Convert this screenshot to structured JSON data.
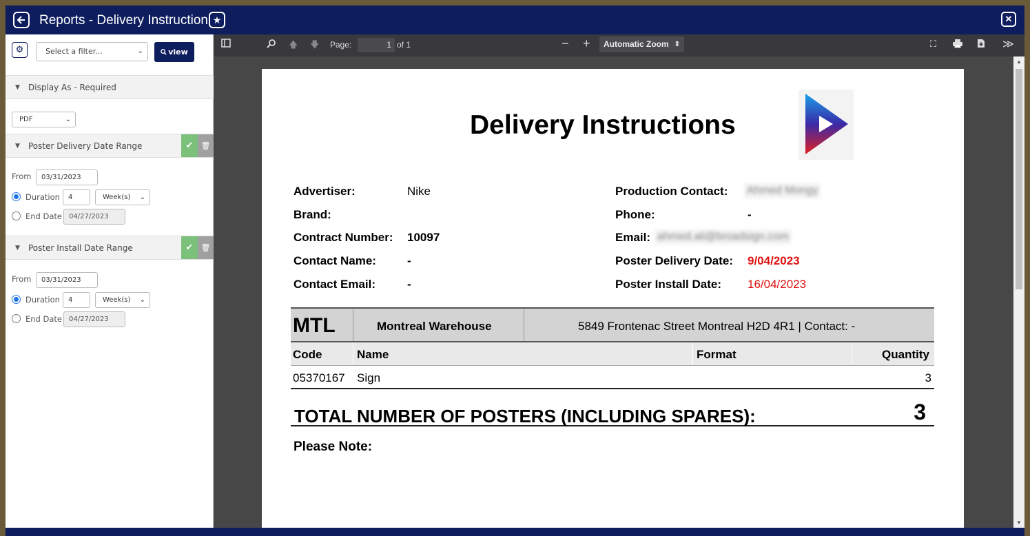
{
  "window": {
    "title": "Reports - Delivery Instruction"
  },
  "filters": {
    "select_placeholder": "Select a filter...",
    "view_label": "view",
    "display_as": {
      "label": "Display As - Required",
      "value": "PDF"
    },
    "delivery": {
      "label": "Poster Delivery Date Range",
      "from_label": "From",
      "from": "03/31/2023",
      "duration_label": "Duration",
      "duration": "4",
      "unit": "Week(s)",
      "end_label": "End Date",
      "end": "04/27/2023"
    },
    "install": {
      "label": "Poster Install Date Range",
      "from_label": "From",
      "from": "03/31/2023",
      "duration_label": "Duration",
      "duration": "4",
      "unit": "Week(s)",
      "end_label": "End Date",
      "end": "04/27/2023"
    }
  },
  "viewer": {
    "page_label": "Page:",
    "page": "1",
    "of": "of 1",
    "zoom": "Automatic Zoom"
  },
  "doc": {
    "title": "Delivery Instructions",
    "left": [
      {
        "label": "Advertiser:",
        "value": "Nike"
      },
      {
        "label": "Brand:",
        "value": ""
      },
      {
        "label": "Contract Number:",
        "value": "10097"
      },
      {
        "label": "Contact Name:",
        "value": "-"
      },
      {
        "label": "Contact Email:",
        "value": "-"
      }
    ],
    "right": [
      {
        "label": "Production Contact:",
        "value": "Ahmed Mongy"
      },
      {
        "label": "Phone:",
        "value": "-"
      },
      {
        "label": "Email:",
        "value": "ahmed.ali@broadsign.com"
      },
      {
        "label": "Poster Delivery Date:",
        "value": "9/04/2023"
      },
      {
        "label": "Poster Install Date:",
        "value": "16/04/2023"
      }
    ],
    "warehouse": {
      "code": "MTL",
      "name": "Montreal Warehouse",
      "address": "5849 Frontenac Street  Montreal H2D 4R1 | Contact: -"
    },
    "table": {
      "headers": [
        "Code",
        "Name",
        "Format",
        "Quantity"
      ],
      "rows": [
        {
          "code": "05370167",
          "name": "Sign",
          "format": "",
          "quantity": "3"
        }
      ]
    },
    "total_label": "TOTAL NUMBER OF POSTERS (INCLUDING SPARES):",
    "total_value": "3",
    "note_label": "Please Note:"
  },
  "colors": {
    "titlebar": "#0d1d5e",
    "accent_red": "#e01010",
    "ok_green": "#7bc07b"
  },
  "icons": [
    "back-icon",
    "star-icon",
    "close-icon",
    "gear-icon",
    "search-icon",
    "sidebar-toggle-icon",
    "arrow-up-icon",
    "arrow-down-icon",
    "fullscreen-icon",
    "print-icon",
    "download-icon",
    "more-icon",
    "check-icon",
    "trash-icon",
    "play-logo-icon"
  ]
}
